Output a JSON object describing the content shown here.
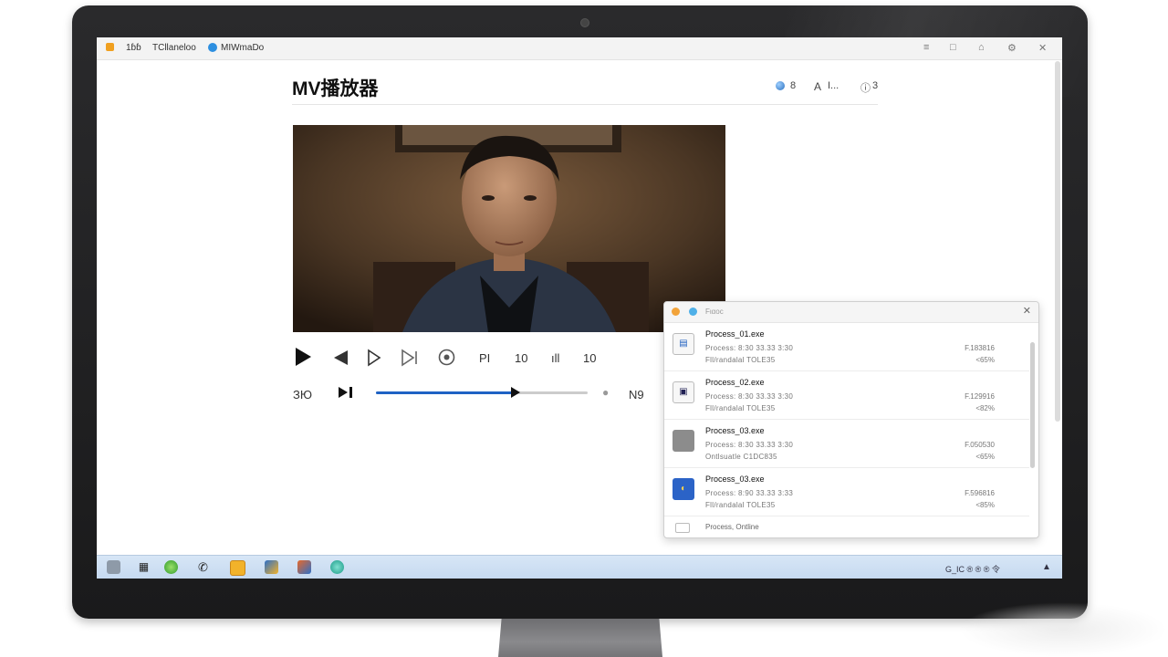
{
  "window": {
    "tab1_label": "1ɓɓ",
    "tab2_label": "TCllaneloo",
    "tab3_label": "MIWmaDo"
  },
  "app": {
    "title": "MV播放器",
    "header_item1": "8",
    "header_item2": "A",
    "header_item3": "I...",
    "header_item4": "3"
  },
  "controls": {
    "label_pl": "PI",
    "value_a": "10",
    "label_bars": "ıll",
    "value_b": "10",
    "time_left": "ЗЮ",
    "time_right": "N9",
    "seek_progress": 0.66
  },
  "panel": {
    "title": "Fιαοc",
    "processes": [
      {
        "name": "Process_01.exe",
        "line1": "Process:    8:30    33.33   3:30",
        "line2": "Fll/randalal  TOLE35",
        "value1": "F.183816",
        "value2": "<65%",
        "icon": "window-blue-icon"
      },
      {
        "name": "Process_02.exe",
        "line1": "Process:    8:30    33.33   3:30",
        "line2": "Fll/randalal  TOLE35",
        "value1": "F.129916",
        "value2": "<82%",
        "icon": "box-icon"
      },
      {
        "name": "Process_03.exe",
        "line1": "Process:    8:30    33.33   3:30",
        "line2": "Ontlsuatle  C1DC835",
        "value1": "F.050530",
        "value2": "<65%",
        "icon": "gray-square-icon"
      },
      {
        "name": "Process_03.exe",
        "line1": "Process:    8:90    33.33   3:33",
        "line2": "Fll/randalal  TOLE35",
        "value1": "F.596816",
        "value2": "<85%",
        "icon": "app-blue-icon"
      }
    ],
    "footer_label": "Process,   Ontline"
  },
  "taskbar": {
    "tray_text": "G_IC ® ® ® 令"
  }
}
